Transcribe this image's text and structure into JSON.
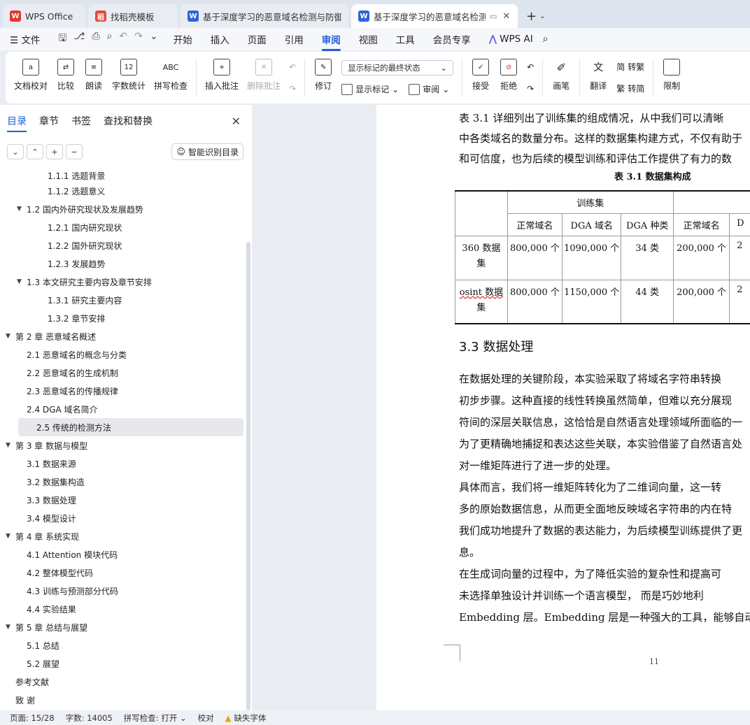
{
  "tabs": [
    {
      "label": "WPS Office",
      "icon": "wps-logo-icon",
      "active": false
    },
    {
      "label": "找稻壳模板",
      "icon": "template-icon",
      "active": false
    },
    {
      "label": "基于深度学习的恶意域名检测与防御…",
      "icon": "word-doc-icon",
      "active": false
    },
    {
      "label": "基于深度学习的恶意域名检测…",
      "icon": "word-doc-icon",
      "active": true
    }
  ],
  "menu": {
    "file": "文件",
    "items": [
      "开始",
      "插入",
      "页面",
      "引用",
      "审阅",
      "视图",
      "工具",
      "会员专享"
    ],
    "active": "审阅",
    "ai": "WPS AI"
  },
  "ribbon": {
    "doc_check": "文档校对",
    "compare": "比较",
    "read_aloud": "朗读",
    "word_count": "字数统计",
    "word_count_icon": "12",
    "spell_check": "拼写检查",
    "spell_icon": "ABC",
    "insert_comment": "插入批注",
    "delete_comment": "删除批注",
    "revise": "修订",
    "markup_select": "显示标记的最终状态",
    "show_markup": "显示标记",
    "review": "审阅",
    "accept": "接受",
    "reject": "拒绝",
    "pen": "画笔",
    "translate": "翻译",
    "to_traditional": "转繁",
    "to_simplified": "转简",
    "restrict": "限制"
  },
  "nav": {
    "tabs": [
      "目录",
      "章节",
      "书签",
      "查找和替换"
    ],
    "active_tab": "目录",
    "smart_btn": "智能识别目录",
    "items": [
      {
        "text": "1.1.1  选题背景",
        "level": 3,
        "caret": false
      },
      {
        "text": "1.1.2  选题意义",
        "level": 3,
        "caret": false
      },
      {
        "text": "1.2  国内外研究现状及发展趋势",
        "level": 2,
        "caret": true
      },
      {
        "text": "1.2.1  国内研究现状",
        "level": 3,
        "caret": false
      },
      {
        "text": "1.2.2  国外研究现状",
        "level": 3,
        "caret": false
      },
      {
        "text": "1.2.3  发展趋势",
        "level": 3,
        "caret": false
      },
      {
        "text": "1.3  本文研究主要内容及章节安排",
        "level": 2,
        "caret": true
      },
      {
        "text": "1.3.1  研究主要内容",
        "level": 3,
        "caret": false
      },
      {
        "text": "1.3.2  章节安排",
        "level": 3,
        "caret": false
      },
      {
        "text": "第 2 章  恶意域名概述",
        "level": 1,
        "caret": true
      },
      {
        "text": "2.1  恶意域名的概念与分类",
        "level": 2,
        "caret": false
      },
      {
        "text": "2.2  恶意域名的生成机制",
        "level": 2,
        "caret": false
      },
      {
        "text": "2.3  恶意域名的传播规律",
        "level": 2,
        "caret": false
      },
      {
        "text": "2.4 DGA 域名简介",
        "level": 2,
        "caret": false
      },
      {
        "text": "2.5  传统的检测方法",
        "level": 2,
        "caret": false,
        "selected": true
      },
      {
        "text": "第 3 章  数据与模型",
        "level": 1,
        "caret": true
      },
      {
        "text": "3.1  数据来源",
        "level": 2,
        "caret": false
      },
      {
        "text": "3.2  数据集构造",
        "level": 2,
        "caret": false
      },
      {
        "text": "3.3  数据处理",
        "level": 2,
        "caret": false
      },
      {
        "text": "3.4  模型设计",
        "level": 2,
        "caret": false
      },
      {
        "text": "第 4 章  系统实现",
        "level": 1,
        "caret": true
      },
      {
        "text": "4.1 Attention 模块代码",
        "level": 2,
        "caret": false
      },
      {
        "text": "4.2  整体模型代码",
        "level": 2,
        "caret": false
      },
      {
        "text": "4.3  训练与预测部分代码",
        "level": 2,
        "caret": false
      },
      {
        "text": "4.4  实验结果",
        "level": 2,
        "caret": false
      },
      {
        "text": "第 5 章  总结与展望",
        "level": 1,
        "caret": true
      },
      {
        "text": "5.1  总结",
        "level": 2,
        "caret": false
      },
      {
        "text": "5.2  展望",
        "level": 2,
        "caret": false
      },
      {
        "text": "参考文献",
        "level": 1,
        "caret": false
      },
      {
        "text": "致    谢",
        "level": 1,
        "caret": false
      }
    ]
  },
  "doc": {
    "intro_lines": [
      "    表 3.1 详细列出了训练集的组成情况，从中我们可以清晰",
      "中各类域名的数量分布。这样的数据集构建方式，不仅有助于",
      "和可信度，也为后续的模型训练和评估工作提供了有力的数"
    ],
    "table_caption": "表 3.1  数据集构成",
    "table": {
      "group_header": "训练集",
      "columns": [
        "正常域名",
        "DGA 域名",
        "DGA 种类",
        "正常域名",
        "D"
      ],
      "rows": [
        {
          "name1": "360 数据",
          "name2": "集",
          "cells": [
            "800,000 个",
            "1090,000 个",
            "34 类",
            "200,000 个",
            "2"
          ]
        },
        {
          "name1": "osint 数据",
          "name2": "集",
          "cells": [
            "800,000 个",
            "1150,000 个",
            "44 类",
            "200,000 个",
            "2"
          ]
        }
      ]
    },
    "section_heading": "3.3  数据处理",
    "body_lines": [
      "    在数据处理的关键阶段，本实验采取了将域名字符串转换",
      "初步步骤。这种直接的线性转换虽然简单，但难以充分展现",
      "符间的深层关联信息，这恰恰是自然语言处理领域所面临的一",
      "为了更精确地捕捉和表达这些关联，本实验借鉴了自然语言处",
      "对一维矩阵进行了进一步的处理。",
      "    具体而言，我们将一维矩阵转化为了二维词向量，这一转",
      "多的原始数据信息，从而更全面地反映域名字符串的内在特",
      "我们成功地提升了数据的表达能力，为后续模型训练提供了更",
      "息。",
      "    在生成词向量的过程中，为了降低实验的复杂性和提高可",
      "未选择单独设计并训练一个语言模型， 而是巧妙地利",
      "Embedding 层。Embedding 层是一种强大的工具，能够自动生"
    ],
    "page_number": "11"
  },
  "status": {
    "page": "页面: 15/28",
    "words": "字数: 14005",
    "spell": "拼写检查: 打开",
    "proof": "校对",
    "missing_font": "缺失字体"
  }
}
